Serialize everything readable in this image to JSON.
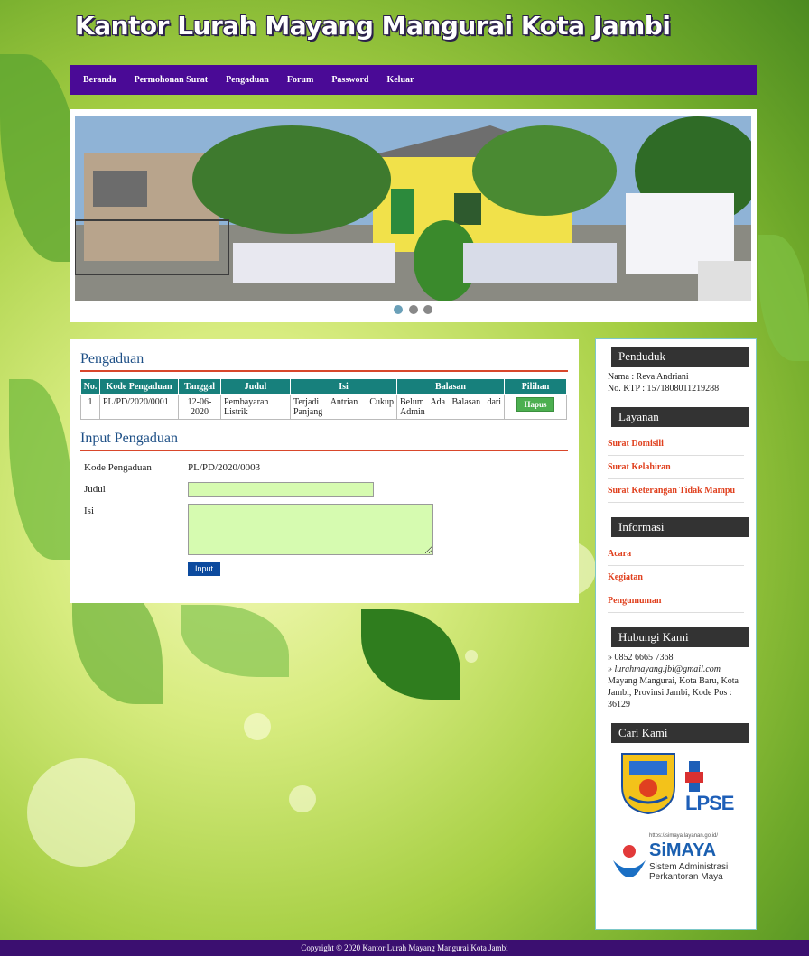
{
  "site": {
    "title": "Kantor Lurah Mayang Mangurai Kota Jambi"
  },
  "nav": [
    "Beranda",
    "Permohonan Surat",
    "Pengaduan",
    "Forum",
    "Password",
    "Keluar"
  ],
  "pengaduan": {
    "heading": "Pengaduan",
    "columns": [
      "No.",
      "Kode Pengaduan",
      "Tanggal",
      "Judul",
      "Isi",
      "Balasan",
      "Pilihan"
    ],
    "rows": [
      {
        "no": "1",
        "kode": "PL/PD/2020/0001",
        "tanggal": "12-06-2020",
        "judul": "Pembayaran Listrik",
        "isi": "Terjadi Antrian Cukup Panjang",
        "balasan": "Belum Ada Balasan dari Admin",
        "aksi": "Hapus"
      }
    ]
  },
  "input_form": {
    "heading": "Input Pengaduan",
    "kode_label": "Kode Pengaduan",
    "kode_value": "PL/PD/2020/0003",
    "judul_label": "Judul",
    "judul_value": "",
    "isi_label": "Isi",
    "isi_value": "",
    "submit_label": "Input"
  },
  "sidebar": {
    "penduduk": {
      "heading": "Penduduk",
      "nama": "Nama : Reva Andriani",
      "ktp": "No. KTP : 1571808011219288"
    },
    "layanan": {
      "heading": "Layanan",
      "links": [
        "Surat Domisili",
        "Surat Kelahiran",
        "Surat Keterangan Tidak Mampu"
      ]
    },
    "informasi": {
      "heading": "Informasi",
      "links": [
        "Acara",
        "Kegiatan",
        "Pengumuman"
      ]
    },
    "hubungi": {
      "heading": "Hubungi Kami",
      "phone": "» 0852 6665 7368",
      "email": "» lurahmayang.jbi@gmail.com",
      "address": "Mayang Mangurai, Kota Baru, Kota Jambi, Provinsi Jambi, Kode Pos : 36129"
    },
    "cari": {
      "heading": "Cari Kami",
      "logo_lpse": "LPSE",
      "logo_simaya_title": "SiMAYA",
      "logo_simaya_sub": "Sistem Administrasi Perkantoran Maya",
      "logo_simaya_url": "https://simaya.layanan.go.id/"
    }
  },
  "footer": {
    "text": "Copyright © 2020 Kantor Lurah Mayang Mangurai Kota Jambi"
  },
  "colors": {
    "nav": "#4a0a96",
    "table_header": "#17807c",
    "accent_link": "#e0401e",
    "footer": "#3b0f70"
  }
}
